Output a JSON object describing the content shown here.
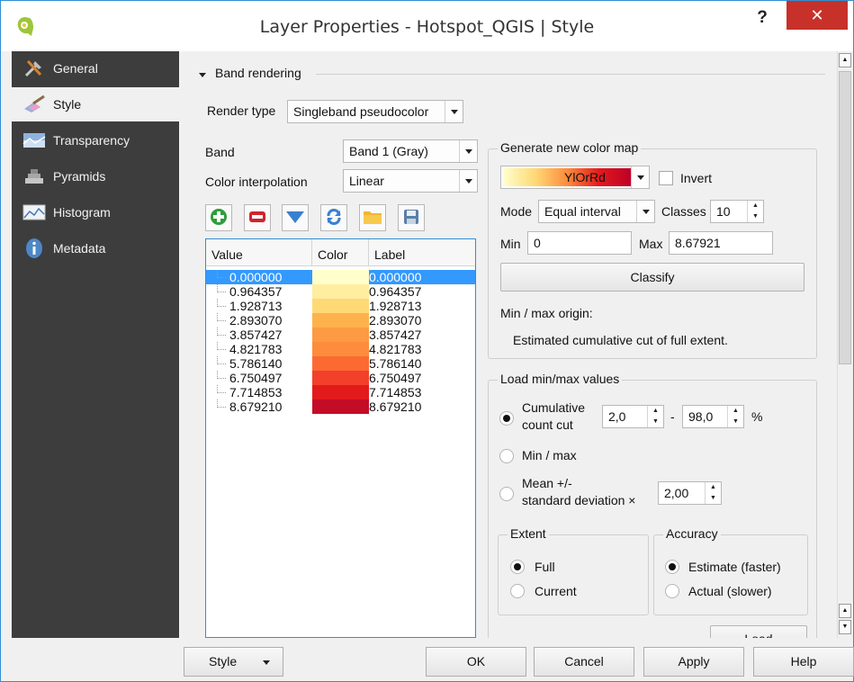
{
  "window": {
    "title": "Layer Properties - Hotspot_QGIS | Style",
    "help": "?",
    "close": "✕"
  },
  "sidebar": {
    "items": [
      {
        "label": "General",
        "icon": "general-icon"
      },
      {
        "label": "Style",
        "icon": "style-brush-icon"
      },
      {
        "label": "Transparency",
        "icon": "transparency-icon"
      },
      {
        "label": "Pyramids",
        "icon": "pyramids-icon"
      },
      {
        "label": "Histogram",
        "icon": "histogram-icon"
      },
      {
        "label": "Metadata",
        "icon": "info-icon"
      }
    ],
    "active": "Style"
  },
  "band_rendering": {
    "title": "Band rendering",
    "render_type_label": "Render type",
    "render_type_value": "Singleband pseudocolor",
    "band_label": "Band",
    "band_value": "Band 1 (Gray)",
    "interp_label": "Color interpolation",
    "interp_value": "Linear"
  },
  "table": {
    "headers": [
      "Value",
      "Color",
      "Label"
    ],
    "rows": [
      {
        "value": "0.000000",
        "label": "0.000000",
        "color": "#ffffcc",
        "selected": true
      },
      {
        "value": "0.964357",
        "label": "0.964357",
        "color": "#ffeda0"
      },
      {
        "value": "1.928713",
        "label": "1.928713",
        "color": "#fed976"
      },
      {
        "value": "2.893070",
        "label": "2.893070",
        "color": "#feb24c"
      },
      {
        "value": "3.857427",
        "label": "3.857427",
        "color": "#fd9a44"
      },
      {
        "value": "4.821783",
        "label": "4.821783",
        "color": "#fd8d3c"
      },
      {
        "value": "5.786140",
        "label": "5.786140",
        "color": "#fc6a32"
      },
      {
        "value": "6.750497",
        "label": "6.750497",
        "color": "#f3402b"
      },
      {
        "value": "7.714853",
        "label": "7.714853",
        "color": "#e31a1c"
      },
      {
        "value": "8.679210",
        "label": "8.679210",
        "color": "#c40c26"
      }
    ]
  },
  "colormap": {
    "title": "Generate new color map",
    "ramp_name": "YlOrRd",
    "invert_label": "Invert",
    "mode_label": "Mode",
    "mode_value": "Equal interval",
    "classes_label": "Classes",
    "classes_value": "10",
    "min_label": "Min",
    "min_value": "0",
    "max_label": "Max",
    "max_value": "8.67921",
    "classify": "Classify",
    "origin_label": "Min / max origin:",
    "origin_value": "Estimated cumulative cut of full extent."
  },
  "minmax": {
    "title": "Load min/max values",
    "cumulative_label_1": "Cumulative",
    "cumulative_label_2": "count cut",
    "cut_low": "2,0",
    "dash": "-",
    "cut_high": "98,0",
    "percent": "%",
    "minmax_label": "Min / max",
    "mean_label_1": "Mean +/-",
    "mean_label_2": "standard deviation ×",
    "stddev_value": "2,00",
    "extent_title": "Extent",
    "extent_full": "Full",
    "extent_current": "Current",
    "accuracy_title": "Accuracy",
    "accuracy_estimate": "Estimate (faster)",
    "accuracy_actual": "Actual (slower)",
    "load": "Load"
  },
  "footer": {
    "style": "Style",
    "ok": "OK",
    "cancel": "Cancel",
    "apply": "Apply",
    "help": "Help"
  },
  "colors": {
    "accent": "#3399ff",
    "sidebar": "#3d3d3d",
    "close": "#c7312a"
  }
}
